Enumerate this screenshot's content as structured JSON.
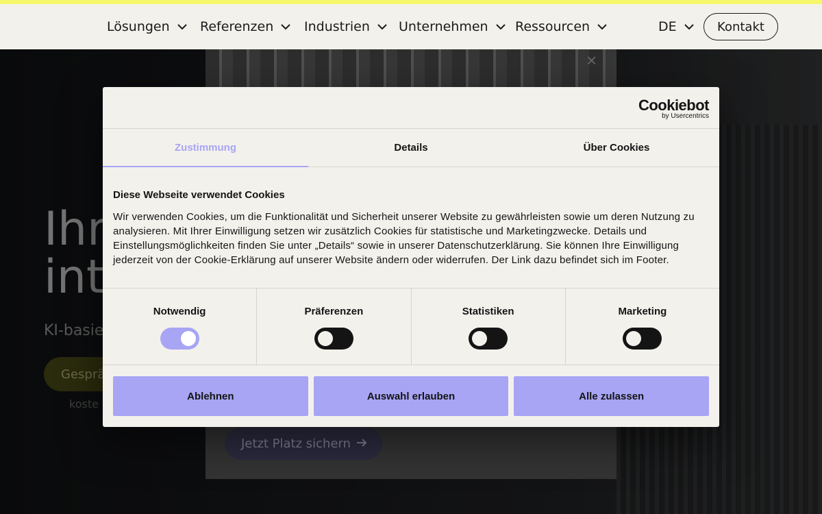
{
  "nav": {
    "items": [
      {
        "label": "Lösungen"
      },
      {
        "label": "Referenzen"
      },
      {
        "label": "Industrien"
      },
      {
        "label": "Unternehmen"
      },
      {
        "label": "Ressourcen"
      }
    ],
    "language": "DE",
    "contact": "Kontakt"
  },
  "hero": {
    "title_line1": "Ihre",
    "title_line2": "inte",
    "subtitle": "KI-basie",
    "cta": "Gesprä",
    "note": "koste"
  },
  "popup": {
    "close": "×",
    "cta": "Jetzt Platz sichern"
  },
  "cookie": {
    "logo": {
      "main": "Cookiebot",
      "sub": "by Usercentrics"
    },
    "tabs": [
      {
        "label": "Zustimmung"
      },
      {
        "label": "Details"
      },
      {
        "label": "Über Cookies"
      }
    ],
    "title": "Diese Webseite verwendet Cookies",
    "text": "Wir verwenden Cookies, um die Funktionalität und Sicherheit unserer Website zu gewährleisten sowie um deren Nutzung zu analysieren. Mit Ihrer Einwilligung setzen wir zusätzlich Cookies für statistische und Marketingzwecke. Details und Einstellungsmöglichkeiten finden Sie unter „Details“ sowie in unserer Datenschutzerklärung. Sie können Ihre Einwilligung jederzeit von der Cookie-Erklärung auf unserer Website ändern oder widerrufen. Der Link dazu befindet sich im Footer.",
    "categories": [
      {
        "label": "Notwendig",
        "checked": true
      },
      {
        "label": "Präferenzen",
        "checked": false
      },
      {
        "label": "Statistiken",
        "checked": false
      },
      {
        "label": "Marketing",
        "checked": false
      }
    ],
    "buttons": {
      "reject": "Ablehnen",
      "selection": "Auswahl erlauben",
      "accept_all": "Alle zulassen"
    }
  },
  "colors": {
    "accent_yellow": "#f6f86b",
    "accent_purple": "#a7a5f4",
    "surface": "#f3f1ec"
  }
}
